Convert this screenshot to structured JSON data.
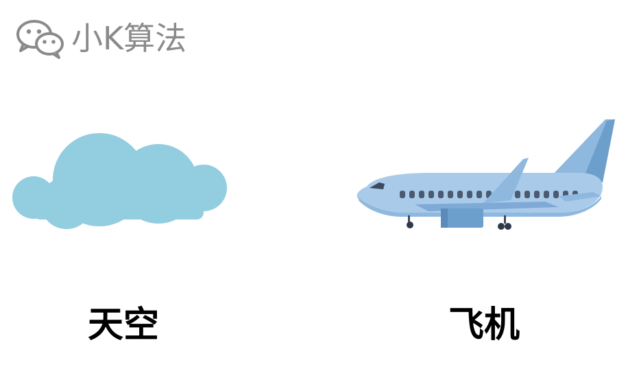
{
  "watermark": {
    "logo_icon": "wechat-icon",
    "brand_name": "小K算法"
  },
  "cards": [
    {
      "icon": "cloud-icon",
      "label": "天空",
      "color": "#92cde0"
    },
    {
      "icon": "airplane-icon",
      "label": "飞机",
      "color": "#a9cbe9"
    }
  ],
  "colors": {
    "background": "#ffffff",
    "watermark_gray": "#8a8a8a",
    "caption_text": "#000000"
  }
}
